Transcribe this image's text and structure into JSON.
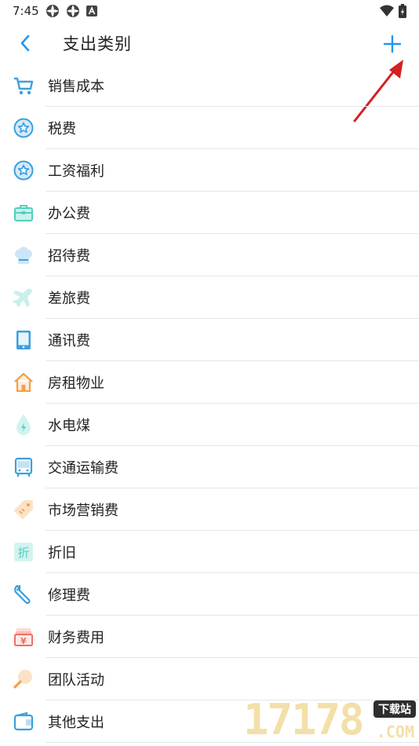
{
  "status_bar": {
    "time": "7:45"
  },
  "header": {
    "title": "支出类别"
  },
  "categories": [
    {
      "label": "销售成本",
      "icon": "cart-icon",
      "color": "#3aa0e0"
    },
    {
      "label": "税费",
      "icon": "star-badge-icon",
      "color": "#3aa0e0"
    },
    {
      "label": "工资福利",
      "icon": "star-badge-icon",
      "color": "#3aa0e0"
    },
    {
      "label": "办公费",
      "icon": "briefcase-icon",
      "color": "#4fd1c0"
    },
    {
      "label": "招待费",
      "icon": "chef-hat-icon",
      "color": "#3aa0e0"
    },
    {
      "label": "差旅费",
      "icon": "airplane-icon",
      "color": "#4fd1c0"
    },
    {
      "label": "通讯费",
      "icon": "tablet-icon",
      "color": "#3aa0e0"
    },
    {
      "label": "房租物业",
      "icon": "house-icon",
      "color": "#f3a04a"
    },
    {
      "label": "水电煤",
      "icon": "water-drop-icon",
      "color": "#4fd1c0"
    },
    {
      "label": "交通运输费",
      "icon": "bus-icon",
      "color": "#3aa0e0"
    },
    {
      "label": "市场营销费",
      "icon": "tag-icon",
      "color": "#f3a04a"
    },
    {
      "label": "折旧",
      "icon": "depreciation-icon",
      "color": "#4fd1c0"
    },
    {
      "label": "修理费",
      "icon": "wrench-icon",
      "color": "#3aa0e0"
    },
    {
      "label": "财务费用",
      "icon": "yuan-box-icon",
      "color": "#f07060"
    },
    {
      "label": "团队活动",
      "icon": "magnifier-icon",
      "color": "#f3a04a"
    },
    {
      "label": "其他支出",
      "icon": "wallet-icon",
      "color": "#3aa0e0"
    }
  ],
  "icon_glyphs": {
    "depreciation": "折",
    "yuan": "¥"
  },
  "watermark": {
    "digits": "17178",
    "badge": "下载站",
    "suffix": ".COM"
  },
  "colors": {
    "accent": "#2196f3",
    "annotation_arrow": "#d42020"
  }
}
